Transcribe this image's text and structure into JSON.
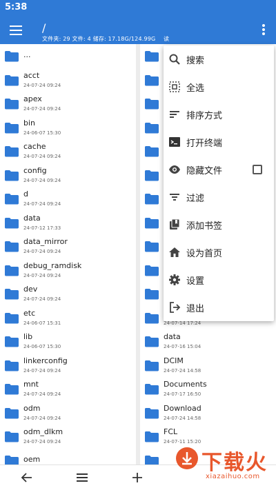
{
  "status_bar": {
    "time": "5:38"
  },
  "app_bar": {
    "path": "/",
    "stats": "文件夹: 29 文件: 4 储存: 17.18G/124.99G",
    "mode": "读"
  },
  "colors": {
    "primary": "#2f7ad6",
    "folder": "#2f7ad6",
    "watermark": "#e8572c"
  },
  "left_pane": {
    "items": [
      {
        "name": "...",
        "date": ""
      },
      {
        "name": "acct",
        "date": "24-07-24 09:24"
      },
      {
        "name": "apex",
        "date": "24-07-24 09:24"
      },
      {
        "name": "bin",
        "date": "24-06-07 15:30"
      },
      {
        "name": "cache",
        "date": "24-07-24 09:24"
      },
      {
        "name": "config",
        "date": "24-07-24 09:24"
      },
      {
        "name": "d",
        "date": "24-07-24 09:24"
      },
      {
        "name": "data",
        "date": "24-07-12 17:33"
      },
      {
        "name": "data_mirror",
        "date": "24-07-24 09:24"
      },
      {
        "name": "debug_ramdisk",
        "date": "24-07-24 09:24"
      },
      {
        "name": "dev",
        "date": "24-07-24 09:24"
      },
      {
        "name": "etc",
        "date": "24-06-07 15:31"
      },
      {
        "name": "lib",
        "date": "24-06-07 15:30"
      },
      {
        "name": "linkerconfig",
        "date": "24-07-24 09:24"
      },
      {
        "name": "mnt",
        "date": "24-07-24 09:24"
      },
      {
        "name": "odm",
        "date": "24-07-24 09:24"
      },
      {
        "name": "odm_dlkm",
        "date": "24-07-24 09:24"
      },
      {
        "name": "oem",
        "date": ""
      }
    ]
  },
  "right_pane": {
    "partial_items": [
      {
        "name": "",
        "date": ""
      },
      {
        "name": "",
        "date": ""
      },
      {
        "name": "",
        "date": ""
      },
      {
        "name": "",
        "date": ""
      },
      {
        "name": "",
        "date": ""
      },
      {
        "name": "",
        "date": ""
      },
      {
        "name": "",
        "date": ""
      },
      {
        "name": "",
        "date": ""
      },
      {
        "name": "",
        "date": ""
      },
      {
        "name": "",
        "date": ""
      },
      {
        "name": "",
        "date": ""
      },
      {
        "name": "",
        "date": "24-07-14 17:24"
      },
      {
        "name": "data",
        "date": "24-07-16 15:04"
      },
      {
        "name": "DCIM",
        "date": "24-07-24 14:58"
      },
      {
        "name": "Documents",
        "date": "24-07-17 16:50"
      },
      {
        "name": "Download",
        "date": "24-07-24 14:58"
      },
      {
        "name": "FCL",
        "date": "24-07-11 15:20"
      },
      {
        "name": "",
        "date": ""
      }
    ]
  },
  "menu": {
    "items": [
      {
        "label": "搜索",
        "icon": "search-icon"
      },
      {
        "label": "全选",
        "icon": "select-all-icon"
      },
      {
        "label": "排序方式",
        "icon": "sort-icon"
      },
      {
        "label": "打开终端",
        "icon": "terminal-icon"
      },
      {
        "label": "隐藏文件",
        "icon": "eye-icon",
        "checkbox": true,
        "checked": false
      },
      {
        "label": "过滤",
        "icon": "filter-icon"
      },
      {
        "label": "添加书签",
        "icon": "bookmark-icon"
      },
      {
        "label": "设为首页",
        "icon": "home-icon"
      },
      {
        "label": "设置",
        "icon": "gear-icon"
      },
      {
        "label": "退出",
        "icon": "exit-icon"
      }
    ]
  },
  "watermark": {
    "text": "下载火",
    "sub": "xiazaihuo.com"
  }
}
